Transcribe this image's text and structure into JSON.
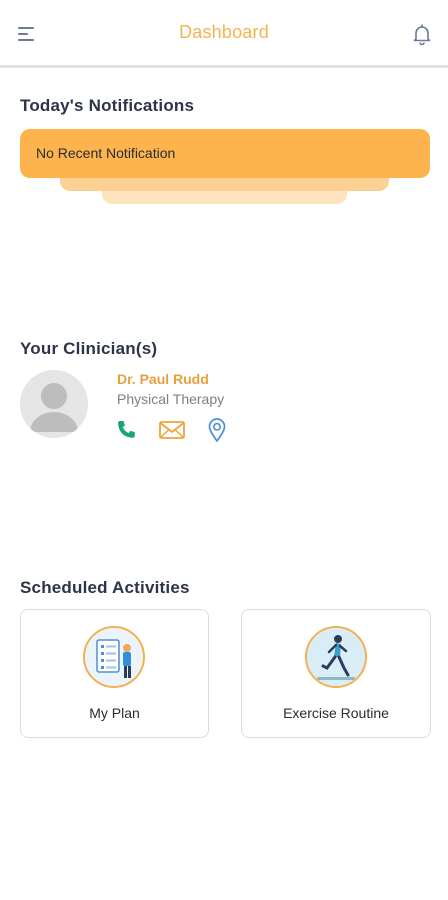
{
  "header": {
    "title": "Dashboard",
    "menu_icon": "menu-icon",
    "bell_icon": "bell-icon"
  },
  "notifications": {
    "title": "Today's Notifications",
    "message": "No Recent Notification"
  },
  "clinicians": {
    "title": "Your Clinician(s)",
    "items": [
      {
        "name": "Dr. Paul Rudd",
        "specialty": "Physical Therapy",
        "actions": [
          "phone-icon",
          "mail-icon",
          "location-icon"
        ]
      }
    ]
  },
  "activities": {
    "title": "Scheduled Activities",
    "items": [
      {
        "label": "My Plan",
        "icon": "plan-illustration"
      },
      {
        "label": "Exercise Routine",
        "icon": "exercise-illustration"
      }
    ]
  },
  "colors": {
    "accent": "#f7b24e",
    "notification_card": "#fdb44e",
    "clinician_name": "#e9a03c",
    "phone": "#1aa37a",
    "mail": "#f0a23a",
    "location": "#4a8fd6"
  }
}
